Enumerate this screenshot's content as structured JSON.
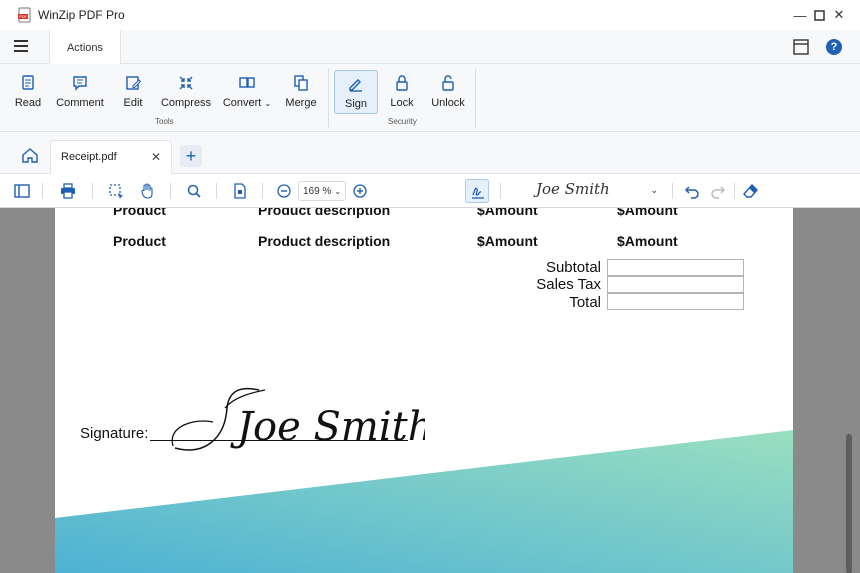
{
  "app": {
    "title": "WinZip PDF Pro"
  },
  "window": {
    "minimize": "—",
    "maximize": "☐",
    "close": "✕"
  },
  "ribbon_tabs": {
    "actions": "Actions"
  },
  "ribbon": {
    "tools": [
      {
        "label": "Read",
        "icon": "read-icon"
      },
      {
        "label": "Comment",
        "icon": "comment-icon"
      },
      {
        "label": "Edit",
        "icon": "edit-icon"
      },
      {
        "label": "Compress",
        "icon": "compress-icon"
      },
      {
        "label": "Convert",
        "icon": "convert-icon"
      },
      {
        "label": "Merge",
        "icon": "merge-icon"
      }
    ],
    "tools_group": "Tools",
    "security": [
      {
        "label": "Sign",
        "icon": "sign-icon"
      },
      {
        "label": "Lock",
        "icon": "lock-icon"
      },
      {
        "label": "Unlock",
        "icon": "unlock-icon"
      }
    ],
    "security_group": "Security"
  },
  "doc_tabs": {
    "active": "Receipt.pdf",
    "close": "✕",
    "new": "+"
  },
  "toolbar": {
    "zoom": "169 %",
    "signature": "Joe Smith"
  },
  "document": {
    "rows": [
      {
        "product": "Product",
        "description": "Product description",
        "amount1": "$Amount",
        "amount2": "$Amount"
      },
      {
        "product": "Product",
        "description": "Product description",
        "amount1": "$Amount",
        "amount2": "$Amount"
      }
    ],
    "summary": {
      "subtotal": "Subtotal",
      "sales_tax": "Sales Tax",
      "total": "Total"
    },
    "signature_label": "Signature:",
    "signature_name": "Joe Smith"
  },
  "colors": {
    "accent": "#1f5fb4",
    "gradient_start": "#4eb2d4",
    "gradient_end": "#9adfc0"
  }
}
